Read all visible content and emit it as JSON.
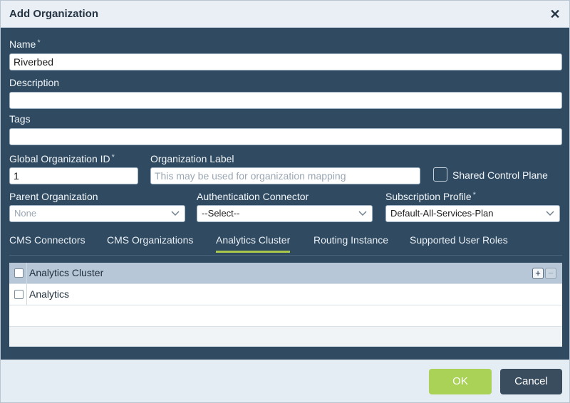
{
  "dialog": {
    "title": "Add Organization",
    "close_glyph": "✕"
  },
  "form": {
    "name": {
      "label": "Name",
      "required": "*",
      "value": "Riverbed"
    },
    "description": {
      "label": "Description",
      "value": ""
    },
    "tags": {
      "label": "Tags",
      "value": ""
    },
    "global_org_id": {
      "label": "Global Organization ID",
      "required": "*",
      "value": "1"
    },
    "org_label": {
      "label": "Organization Label",
      "placeholder": "This may be used for organization mapping",
      "value": ""
    },
    "shared_control_plane": {
      "label": "Shared Control Plane",
      "checked": false
    },
    "parent_org": {
      "label": "Parent Organization",
      "value": "None"
    },
    "auth_connector": {
      "label": "Authentication Connector",
      "value": "--Select--"
    },
    "subscription_profile": {
      "label": "Subscription Profile",
      "required": "*",
      "value": "Default-All-Services-Plan"
    }
  },
  "tabs": [
    {
      "label": "CMS Connectors",
      "active": false
    },
    {
      "label": "CMS Organizations",
      "active": false
    },
    {
      "label": "Analytics Cluster",
      "active": true
    },
    {
      "label": "Routing Instance",
      "active": false
    },
    {
      "label": "Supported User Roles",
      "active": false
    }
  ],
  "table": {
    "header": "Analytics Cluster",
    "add_glyph": "+",
    "remove_glyph": "−",
    "rows": [
      {
        "label": "Analytics"
      }
    ]
  },
  "footer": {
    "ok_label": "OK",
    "cancel_label": "Cancel"
  },
  "colors": {
    "accent": "#a9d256",
    "panel": "#2f4a61",
    "header_row": "#b7c7d8"
  }
}
